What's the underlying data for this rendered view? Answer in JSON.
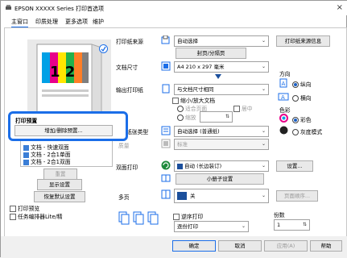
{
  "window": {
    "title": "EPSON XXXXX Series 打印首选项",
    "close": "×"
  },
  "tabs": [
    "主窗口",
    "印质处理",
    "更多选项",
    "维护"
  ],
  "preview": {
    "page_numbers": "1 2"
  },
  "left": {
    "print_presets_title": "打印预置",
    "add_remove_button": "增加/删除预置...",
    "list_items": [
      "文档 - 快速双面",
      "文档 - 2合1单面",
      "文档 - 2合1双面"
    ],
    "reset_button": "重置",
    "show_settings_button": "显示设置",
    "restore_defaults_button": "恢复默认设置",
    "print_preview_label": "打印预览",
    "job_arranger_label": "任务编排器Lite/精"
  },
  "main": {
    "paper_source_label": "打印纸来源",
    "paper_source_value": "自动选择",
    "paper_source_info_button": "打印纸来源信息",
    "paper_settings_button": "封页/分隔页",
    "doc_size_label": "文档尺寸",
    "doc_size_value": "A4 210 x 297 毫米",
    "output_paper_label": "输出打印纸",
    "output_paper_value": "与文档尺寸相同",
    "reduce_enlarge_label": "缩小/放大文档",
    "fit_to_page_label": "适合页面",
    "zoom_label": "缩放",
    "center_label": "居中",
    "orientation_label": "方向",
    "portrait_label": "纵向",
    "landscape_label": "横向",
    "paper_type_label": "纸张类型",
    "paper_type_value": "自动选择 (普通纸)",
    "quality_label": "质量",
    "quality_value": "标准",
    "color_label": "色彩",
    "color_option": "彩色",
    "grayscale_option": "灰度模式",
    "duplex_label": "双面打印",
    "duplex_value": "自动 (长边装订)",
    "duplex_settings_button": "设置...",
    "booklet_button": "小册子设置",
    "multipage_label": "多页",
    "multipage_value": "关",
    "page_order_button": "页面顺序...",
    "reverse_order_label": "逆序打印",
    "collate_value": "逐份打印",
    "copies_label": "份数",
    "copies_value": "1"
  },
  "footer": {
    "ok": "确定",
    "cancel": "取消",
    "apply": "应用(A)",
    "help": "帮助"
  }
}
